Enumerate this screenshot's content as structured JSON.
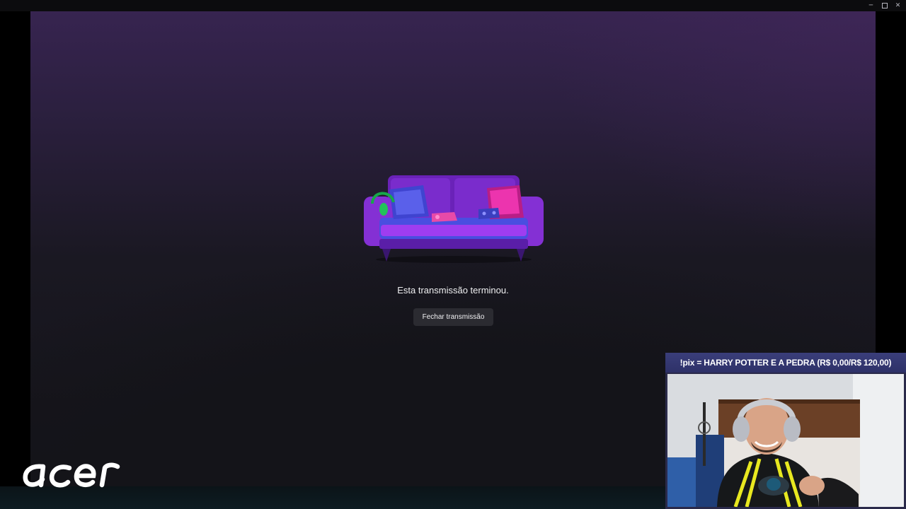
{
  "window": {
    "controls": [
      "minimize-icon",
      "maximize-icon",
      "close-icon"
    ],
    "minimize_glyph": "─",
    "close_glyph": "✕"
  },
  "stream": {
    "ended_message": "Esta transmissão terminou.",
    "close_button_label": "Fechar transmissão"
  },
  "overlay": {
    "banner_text": "!pix = HARRY POTTER E A PEDRA (R$ 0,00/R$ 120,00)"
  },
  "branding": {
    "logo_text": "acer"
  },
  "colors": {
    "stage_top": "#372450",
    "stage_bottom": "#141419",
    "button_bg": "#2b2b31",
    "banner_bg": "#3a3e7a",
    "couch_purple": "#7c2cc8",
    "cushion_blue": "#4a4ee0",
    "pillow_pink": "#e62ea8",
    "headphone_green": "#22c25a"
  }
}
